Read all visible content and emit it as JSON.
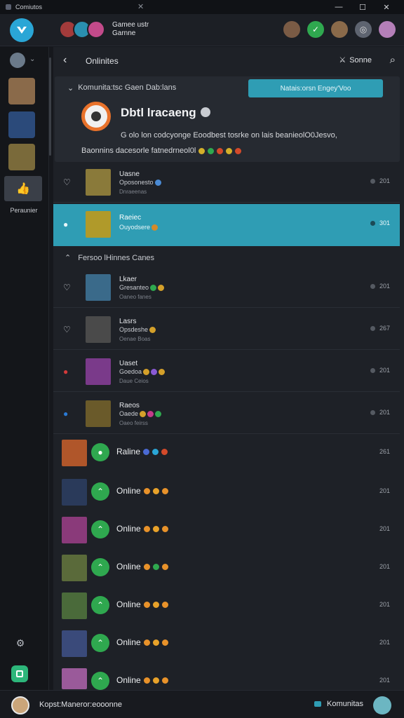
{
  "titlebar": {
    "app_name": "Comiutos",
    "mid_glyph": "✕",
    "min": "—",
    "max": "☐",
    "close": "✕"
  },
  "topbar": {
    "title_line1": "Gamee ustr",
    "title_line2": "Garnne",
    "avatars": [
      "#a33b3b",
      "#2a8fb0",
      "#c24a8a"
    ],
    "right_icons": [
      "#7a5b45",
      "#2fa84f",
      "#8a6a4a",
      "#5e6470",
      "#b47fb8"
    ]
  },
  "sidebar": {
    "active_label": "Peraunier",
    "items": [
      "#6b7a8a",
      "#8a6a4a",
      "#2b4a7a",
      "#7a6a3a"
    ]
  },
  "main": {
    "title": "Onlinites",
    "back_glyph": "‹",
    "right_label": "Sonne",
    "right_glyph": "⚔",
    "search_glyph": "⌕"
  },
  "info": {
    "top_label": "Komunita:tsc Gaen Dab:lans",
    "top_glyph": "⌄",
    "join_label": "Natais:orsn Engey'Voo",
    "name": "Dbtl lracaeng",
    "desc1": "G olo  lon codcyonge  Eoodbest tosrke  on lais beanieolO0Jesvo,",
    "desc2": "Baonnins  dacesorle  fatnedrneol0l"
  },
  "rows": [
    {
      "name": "Uasne",
      "status": "Oposonesto",
      "sub": "Dnraeenas",
      "count": "201",
      "heart": "♡",
      "thumb": "#8a7a3a",
      "highlight": false
    },
    {
      "name": "Raeiec",
      "status": "Ouyodsere",
      "sub": "",
      "count": "301",
      "heart": "●",
      "thumb": "#b09a2a",
      "highlight": true
    }
  ],
  "section": {
    "label": "Fersoo lHinnes Canes",
    "glyph": "⌃"
  },
  "rows2": [
    {
      "name": "Lkaer",
      "status": "Gresanteo",
      "sub": "Oaneo fanes",
      "count": "201",
      "heart": "♡",
      "thumb": "#3a6a8a"
    },
    {
      "name": "Lasrs",
      "status": "Opsdeshe",
      "sub": "Oenae Boas",
      "count": "267",
      "heart": "♡",
      "thumb": "#4a4a4a"
    },
    {
      "name": "Uaset",
      "status": "Goedoa",
      "sub": "Daue Ceios",
      "count": "201",
      "heart": "●",
      "thumb": "#7a3a8a"
    },
    {
      "name": "Raeos",
      "status": "Oaede",
      "sub": "Oaeo feirss",
      "count": "201",
      "heart": "●",
      "thumb": "#6a5a2a"
    }
  ],
  "online": [
    {
      "label": "Raline",
      "count": "261",
      "thumb": "#b0562a"
    },
    {
      "label": "Online",
      "count": "201",
      "thumb": "#2a3a5a"
    },
    {
      "label": "Online",
      "count": "201",
      "thumb": "#8a3a7a"
    },
    {
      "label": "Online",
      "count": "201",
      "thumb": "#5a6a3a"
    },
    {
      "label": "Online",
      "count": "201",
      "thumb": "#4a6a3a"
    },
    {
      "label": "Online",
      "count": "201",
      "thumb": "#3a4a7a"
    },
    {
      "label": "Online",
      "count": "201",
      "thumb": "#9a5a9a"
    }
  ],
  "footer": {
    "text": "Kopst:Maneror:eooonne",
    "right_label": "Komunitas"
  },
  "colors": {
    "accent": "#2f9db4",
    "online_green": "#2fa84f",
    "brand_orange": "#e8722b"
  }
}
